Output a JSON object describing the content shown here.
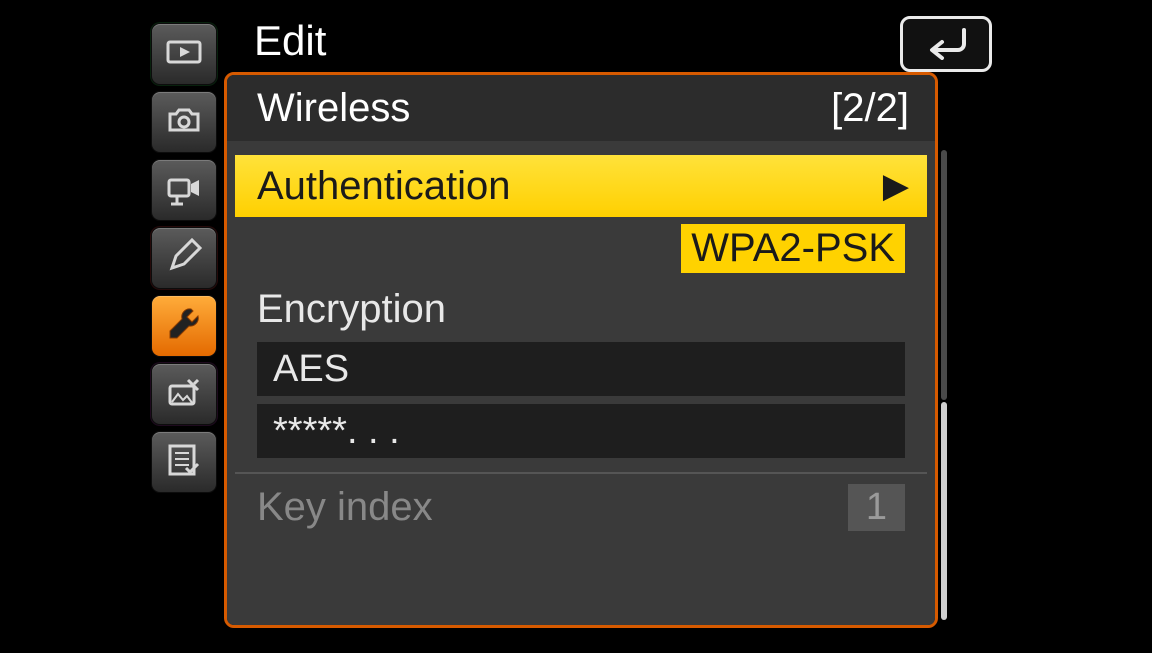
{
  "header": {
    "title": "Edit"
  },
  "panel": {
    "section": "Wireless",
    "page_indicator": "[2/2]"
  },
  "items": {
    "authentication": {
      "label": "Authentication",
      "value": "WPA2-PSK"
    },
    "encryption": {
      "label": "Encryption",
      "cipher": "AES",
      "key_masked": "*****. . ."
    },
    "key_index": {
      "label": "Key index",
      "value": "1"
    }
  },
  "tabs": {
    "playback": "playback",
    "photo": "photo-shooting",
    "movie": "movie-shooting",
    "pencil": "custom-settings",
    "setup": "setup",
    "retouch": "retouch",
    "mymenu": "my-menu"
  }
}
